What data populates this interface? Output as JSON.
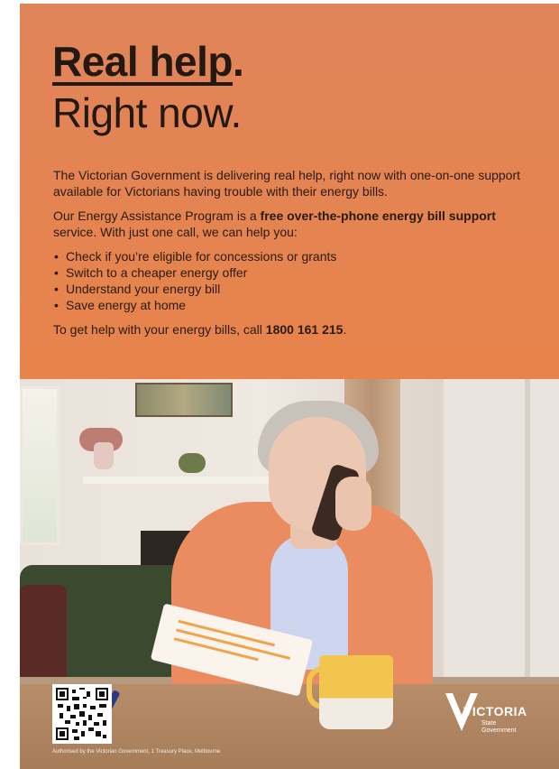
{
  "headline": {
    "line1_underlined": "Real help",
    "line1_dot": ".",
    "line2": "Right now."
  },
  "intro": "The Victorian Government is delivering real help, right now with one-on-one support available for Victorians having trouble with their energy bills.",
  "program": {
    "before": "Our Energy Assistance Program is a ",
    "bold": "free over-the-phone energy bill support",
    "after": " service. With just one call, we can help you:"
  },
  "bullets": [
    "Check if you’re eligible for concessions or grants",
    "Switch to a cheaper energy offer",
    "Understand your energy bill",
    "Save energy at home"
  ],
  "cta": {
    "before": "To get help with your energy bills, call ",
    "phone": "1800 161 215",
    "after": "."
  },
  "footer": {
    "authorised": "Authorised by the Victorian Government, 1 Treasury Place, Melbourne",
    "logo_word": "VICTORIA",
    "logo_sub_1": "State",
    "logo_sub_2": "Government"
  },
  "colors": {
    "banner": "#e4844f",
    "text": "#231812"
  }
}
